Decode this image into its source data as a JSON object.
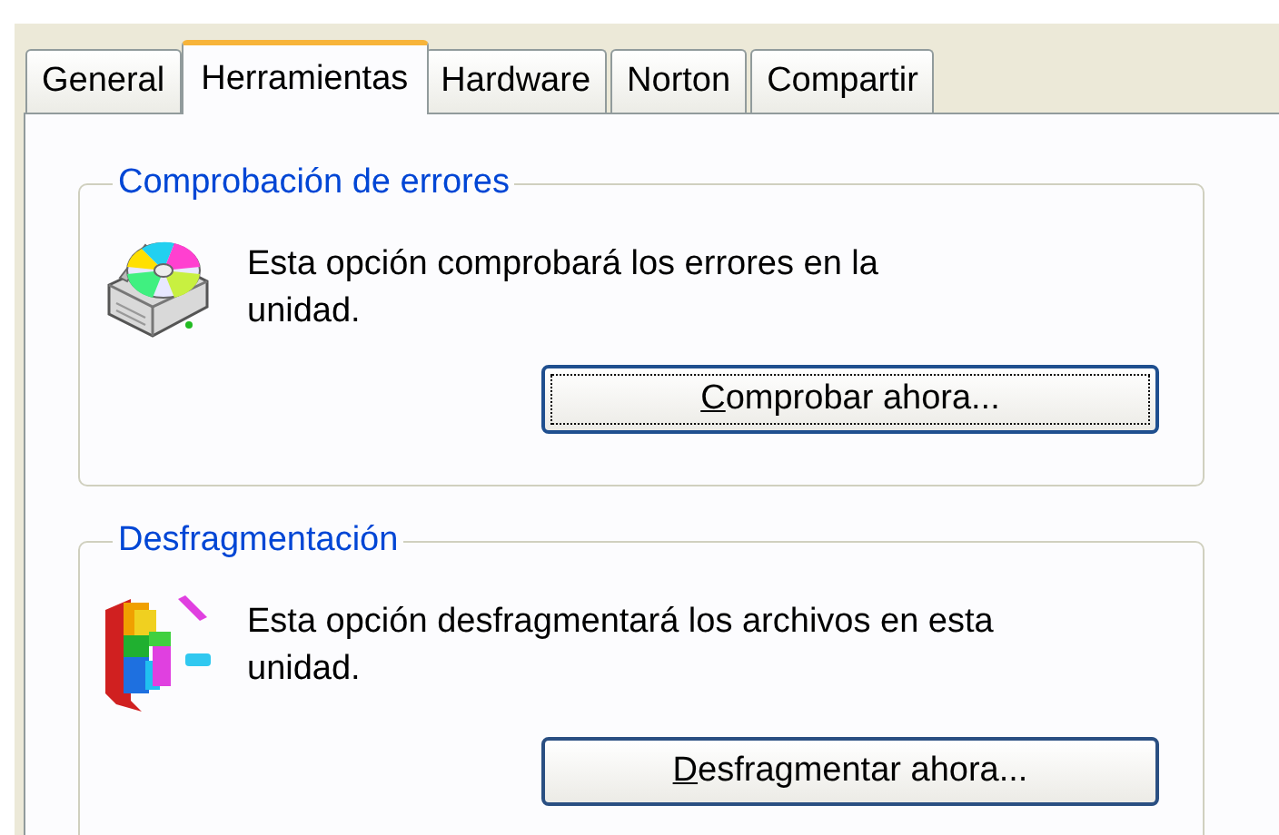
{
  "tabs": [
    {
      "label": "General",
      "selected": false
    },
    {
      "label": "Herramientas",
      "selected": true
    },
    {
      "label": "Hardware",
      "selected": false
    },
    {
      "label": "Norton",
      "selected": false
    },
    {
      "label": "Compartir",
      "selected": false
    }
  ],
  "groups": [
    {
      "title": "Comprobación de errores",
      "kind": "check",
      "text": "Esta opción comprobará los errores en la\nunidad.",
      "button": {
        "label": "Comprobar ahora...",
        "focused": true
      }
    },
    {
      "title": "Desfragmentación",
      "kind": "defrag",
      "text": "Esta opción desfragmentará los archivos en esta\nunidad.",
      "button": {
        "label": "Desfragmentar ahora...",
        "focused": false
      }
    }
  ]
}
